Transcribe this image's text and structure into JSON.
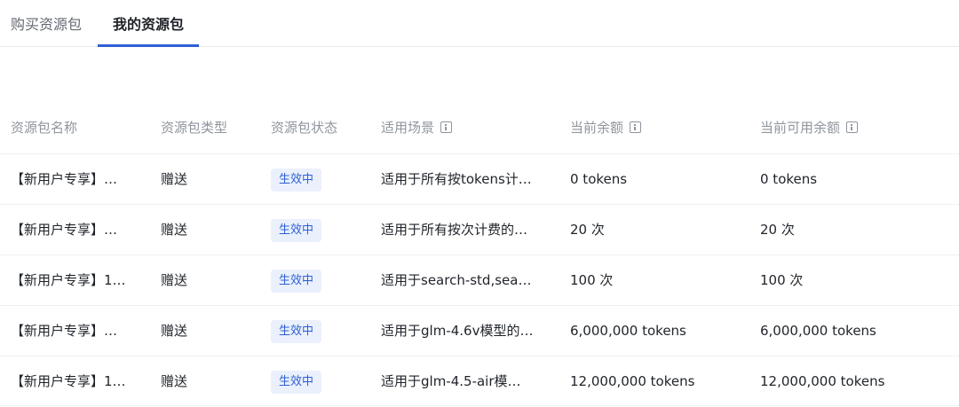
{
  "tabs": [
    {
      "label": "购买资源包",
      "active": false
    },
    {
      "label": "我的资源包",
      "active": true
    }
  ],
  "accent_color": "#2d5fd6",
  "table": {
    "columns": [
      {
        "label": "资源包名称",
        "info": false
      },
      {
        "label": "资源包类型",
        "info": false
      },
      {
        "label": "资源包状态",
        "info": false
      },
      {
        "label": "适用场景",
        "info": true
      },
      {
        "label": "当前余额",
        "info": true
      },
      {
        "label": "当前可用余额",
        "info": true
      }
    ],
    "rows": [
      {
        "name": "【新用户专享】…",
        "type": "赠送",
        "status": "生效中",
        "scene": "适用于所有按tokens计…",
        "balance": "0 tokens",
        "available": "0 tokens"
      },
      {
        "name": "【新用户专享】…",
        "type": "赠送",
        "status": "生效中",
        "scene": "适用于所有按次计费的…",
        "balance": "20 次",
        "available": "20 次"
      },
      {
        "name": "【新用户专享】1…",
        "type": "赠送",
        "status": "生效中",
        "scene": "适用于search-std,sea…",
        "balance": "100 次",
        "available": "100 次"
      },
      {
        "name": "【新用户专享】…",
        "type": "赠送",
        "status": "生效中",
        "scene": "适用于glm-4.6v模型的…",
        "balance": "6,000,000 tokens",
        "available": "6,000,000 tokens"
      },
      {
        "name": "【新用户专享】1…",
        "type": "赠送",
        "status": "生效中",
        "scene": "适用于glm-4.5-air模…",
        "balance": "12,000,000 tokens",
        "available": "12,000,000 tokens"
      }
    ]
  }
}
